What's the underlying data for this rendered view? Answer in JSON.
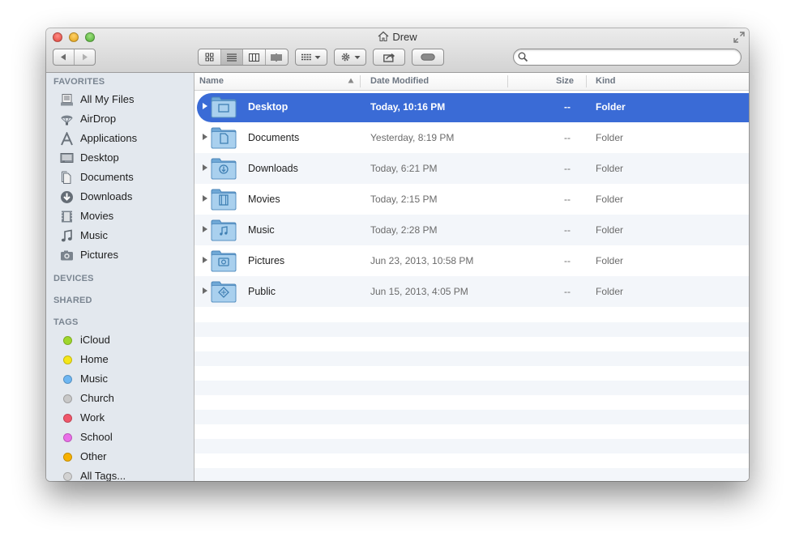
{
  "window": {
    "title": "Drew",
    "title_icon": "home-icon"
  },
  "toolbar": {
    "back_icon": "back-arrow-icon",
    "forward_icon": "forward-arrow-icon",
    "view_modes": [
      "icon-view",
      "list-view",
      "column-view",
      "coverflow-view"
    ],
    "active_view": "list-view",
    "arrange_icon": "arrange-icon",
    "action_icon": "gear-icon",
    "share_icon": "share-icon",
    "tags_icon": "tag-pill-icon",
    "search": {
      "value": "",
      "placeholder": ""
    }
  },
  "sidebar": {
    "favorites_header": "FAVORITES",
    "favorites": [
      {
        "label": "All My Files",
        "icon": "all-files-icon"
      },
      {
        "label": "AirDrop",
        "icon": "airdrop-icon"
      },
      {
        "label": "Applications",
        "icon": "applications-icon"
      },
      {
        "label": "Desktop",
        "icon": "desktop-icon"
      },
      {
        "label": "Documents",
        "icon": "documents-icon"
      },
      {
        "label": "Downloads",
        "icon": "downloads-icon"
      },
      {
        "label": "Movies",
        "icon": "movies-icon"
      },
      {
        "label": "Music",
        "icon": "music-icon"
      },
      {
        "label": "Pictures",
        "icon": "pictures-icon"
      }
    ],
    "devices_header": "DEVICES",
    "shared_header": "SHARED",
    "tags_header": "TAGS",
    "tags": [
      {
        "label": "iCloud",
        "color": "#9fd62b"
      },
      {
        "label": "Home",
        "color": "#f4e619"
      },
      {
        "label": "Music",
        "color": "#6db6f2"
      },
      {
        "label": "Church",
        "color": "#c8c8c8"
      },
      {
        "label": "Work",
        "color": "#f0566a"
      },
      {
        "label": "School",
        "color": "#ea6ee8"
      },
      {
        "label": "Other",
        "color": "#f7b100"
      },
      {
        "label": "All Tags...",
        "color": "#d2d2d2"
      }
    ]
  },
  "columns": {
    "name": "Name",
    "date": "Date Modified",
    "size": "Size",
    "kind": "Kind"
  },
  "files": [
    {
      "name": "Desktop",
      "date": "Today, 10:16 PM",
      "size": "--",
      "kind": "Folder",
      "selected": true,
      "icon": "desktop-folder-icon"
    },
    {
      "name": "Documents",
      "date": "Yesterday, 8:19 PM",
      "size": "--",
      "kind": "Folder",
      "selected": false,
      "icon": "documents-folder-icon"
    },
    {
      "name": "Downloads",
      "date": "Today, 6:21 PM",
      "size": "--",
      "kind": "Folder",
      "selected": false,
      "icon": "downloads-folder-icon"
    },
    {
      "name": "Movies",
      "date": "Today, 2:15 PM",
      "size": "--",
      "kind": "Folder",
      "selected": false,
      "icon": "movies-folder-icon"
    },
    {
      "name": "Music",
      "date": "Today, 2:28 PM",
      "size": "--",
      "kind": "Folder",
      "selected": false,
      "icon": "music-folder-icon"
    },
    {
      "name": "Pictures",
      "date": "Jun 23, 2013, 10:58 PM",
      "size": "--",
      "kind": "Folder",
      "selected": false,
      "icon": "pictures-folder-icon"
    },
    {
      "name": "Public",
      "date": "Jun 15, 2013, 4:05 PM",
      "size": "--",
      "kind": "Folder",
      "selected": false,
      "icon": "public-folder-icon"
    }
  ],
  "colors": {
    "selection": "#3a6bd6",
    "sidebar_bg": "#e3e8ee",
    "row_stripe": "#f3f6fa"
  }
}
